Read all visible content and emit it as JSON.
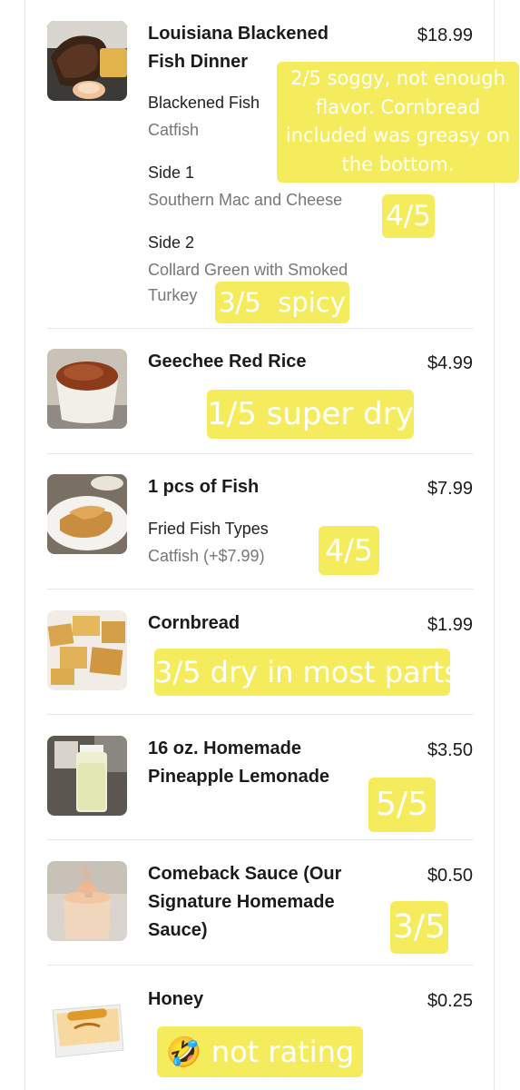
{
  "colors": {
    "note_bg": "#f5ec5d",
    "note_text": "#ffffff",
    "divider": "#e8e8e8",
    "muted_text": "#777777"
  },
  "items": [
    {
      "name_lines": [
        "Louisiana Blackened",
        "Fish Dinner"
      ],
      "price": "$18.99",
      "image": "fish-dinner-photo",
      "modifiers": [
        {
          "title": "Blackened Fish",
          "value": "Catfish"
        },
        {
          "title": "Side 1",
          "value": "Southern Mac and Cheese"
        },
        {
          "title": "Side 2",
          "value_lines": [
            "Collard Green with Smoked",
            "Turkey"
          ]
        }
      ],
      "notes": [
        {
          "lines": [
            "2/5 soggy, not enough",
            "flavor. Cornbread",
            "included was greasy on",
            "the bottom."
          ]
        },
        {
          "text": "4/5"
        },
        {
          "text": "3/5  spicy"
        }
      ]
    },
    {
      "name": "Geechee Red Rice",
      "price": "$4.99",
      "image": "red-rice-photo",
      "note": "1/5 super dry"
    },
    {
      "name": "1 pcs of Fish",
      "price": "$7.99",
      "image": "fried-fish-photo",
      "modifiers": [
        {
          "title": "Fried Fish Types",
          "value": "Catfish (+$7.99)"
        }
      ],
      "note": "4/5"
    },
    {
      "name": "Cornbread",
      "price": "$1.99",
      "image": "cornbread-photo",
      "note": "3/5 dry in most parts"
    },
    {
      "name_lines": [
        "16 oz. Homemade",
        "Pineapple Lemonade"
      ],
      "price": "$3.50",
      "image": "lemonade-photo",
      "note": "5/5"
    },
    {
      "name_lines": [
        "Comeback Sauce (Our",
        "Signature Homemade",
        "Sauce)"
      ],
      "price": "$0.50",
      "image": "comeback-sauce-photo",
      "note": "3/5"
    },
    {
      "name": "Honey",
      "price": "$0.25",
      "image": "honey-packet-photo",
      "note": "not rating",
      "note_emoji": "🤣"
    }
  ]
}
